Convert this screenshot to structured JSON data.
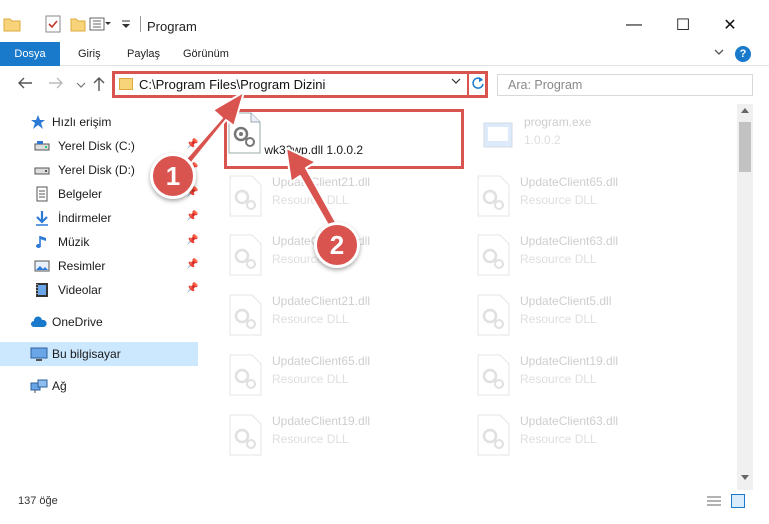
{
  "window": {
    "title": "Program",
    "minimize_glyph": "—",
    "maximize_glyph": "☐",
    "close_glyph": "✕"
  },
  "ribbon": {
    "tabs": [
      "Dosya",
      "Giriş",
      "Paylaş",
      "Görünüm"
    ],
    "help_glyph": "?"
  },
  "address_bar": {
    "path": "C:\\Program Files\\Program Dizini",
    "highlight_color": "#d9534f"
  },
  "search": {
    "placeholder": "Ara: Program"
  },
  "sidebar": {
    "items": [
      {
        "label": "Hızlı erişim",
        "icon": "star-icon"
      },
      {
        "label": "Yerel Disk (C:)",
        "icon": "drive-icon"
      },
      {
        "label": "Yerel Disk (D:)",
        "icon": "drive-icon"
      },
      {
        "label": "Belgeler",
        "icon": "documents-icon"
      },
      {
        "label": "İndirmeler",
        "icon": "download-icon"
      },
      {
        "label": "Müzik",
        "icon": "music-icon"
      },
      {
        "label": "Resimler",
        "icon": "pictures-icon"
      },
      {
        "label": "Videolar",
        "icon": "video-icon"
      },
      {
        "label": "OneDrive",
        "icon": "cloud-icon"
      },
      {
        "label": "Bu bilgisayar",
        "icon": "computer-icon"
      },
      {
        "label": "Ağ",
        "icon": "network-icon"
      }
    ],
    "selected": "Bu bilgisayar"
  },
  "files": [
    {
      "name": "wk30wp.dll",
      "desc": "1.0.0.2",
      "highlighted": true
    },
    {
      "name": "program.exe",
      "desc": "1.0.0.2"
    },
    {
      "name": "UpdateClient21.dll",
      "desc": "Resource DLL"
    },
    {
      "name": "UpdateClient65.dll",
      "desc": "Resource DLL"
    },
    {
      "name": "UpdateClient21.dll",
      "desc": "Resource DLL"
    },
    {
      "name": "UpdateClient63.dll",
      "desc": "Resource DLL"
    },
    {
      "name": "UpdateClient21.dll",
      "desc": "Resource DLL"
    },
    {
      "name": "UpdateClient5.dll",
      "desc": "Resource DLL"
    },
    {
      "name": "UpdateClient65.dll",
      "desc": "Resource DLL"
    },
    {
      "name": "UpdateClient19.dll",
      "desc": "Resource DLL"
    },
    {
      "name": "UpdateClient19.dll",
      "desc": "Resource DLL"
    },
    {
      "name": "UpdateClient63.dll",
      "desc": "Resource DLL"
    }
  ],
  "status": {
    "item_count": "137 öğe"
  },
  "annotations": {
    "marker_1": "1",
    "marker_2": "2",
    "color": "#d9534f"
  },
  "colors": {
    "accent": "#1979ca",
    "selection": "#cce8ff"
  }
}
